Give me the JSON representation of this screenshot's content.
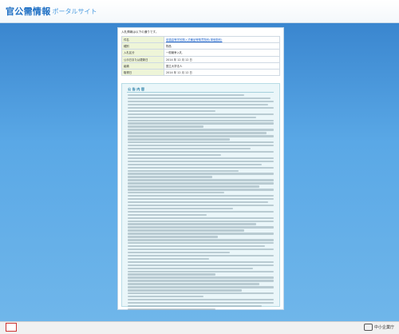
{
  "header": {
    "logo_main": "官公需情報",
    "logo_sub": "ポータルサイト"
  },
  "panel": {
    "intro": "入札情報は以下の通りです。",
    "info_rows": [
      {
        "key": "件名",
        "value": "前橋高等学校購入式備品等購買契約(単価契約)",
        "link": true
      },
      {
        "key": "種別",
        "value": "物品",
        "link": false
      },
      {
        "key": "入札区分",
        "value": "一般競争入札",
        "link": false
      },
      {
        "key": "公示日または更新日",
        "value": "2014 年 12 月 12 日",
        "link": false
      },
      {
        "key": "組織",
        "value": "国立大学法人",
        "link": false
      },
      {
        "key": "取得日",
        "value": "2014 年 12 月 12 日",
        "link": false
      }
    ],
    "notice_title": "公 告 内 容"
  },
  "footer": {
    "seal_label": "",
    "org_name": "中小企業庁"
  }
}
